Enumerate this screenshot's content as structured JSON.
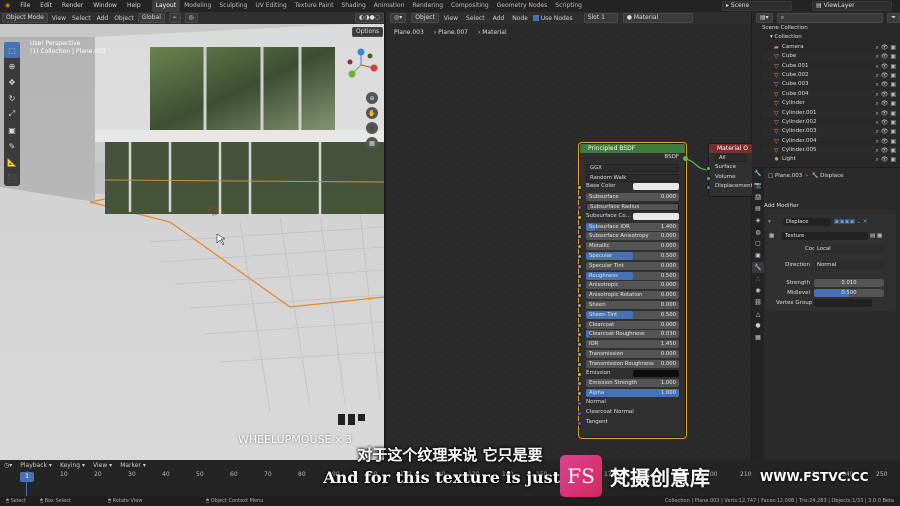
{
  "top_menu": [
    "File",
    "Edit",
    "Render",
    "Window",
    "Help"
  ],
  "workspaces": [
    "Layout",
    "Modeling",
    "Sculpting",
    "UV Editing",
    "Texture Paint",
    "Shading",
    "Animation",
    "Rendering",
    "Compositing",
    "Geometry Nodes",
    "Scripting"
  ],
  "scene": "Scene",
  "view_layer": "ViewLayer",
  "viewport": {
    "mode": "Object Mode",
    "menus": [
      "View",
      "Select",
      "Add",
      "Object"
    ],
    "orientation": "Global",
    "perspective_label": "User Perspective",
    "collection_label": "(1) Collection | Plane.003",
    "options": "Options",
    "keypress_overlay": "WHEELUPMOUSE x 3"
  },
  "node_editor": {
    "type": "Object",
    "menus": [
      "View",
      "Select",
      "Add",
      "Node"
    ],
    "use_nodes": "Use Nodes",
    "slot": "Slot 1",
    "material": "Material",
    "breadcrumb": [
      "Plane.003",
      "Plane.007",
      "Material"
    ],
    "bsdf_node": {
      "title": "Principled BSDF",
      "output": "BSDF",
      "distribution": "GGX",
      "subsurface_method": "Random Walk",
      "rows": [
        {
          "label": "Base Color",
          "kind": "color"
        },
        {
          "label": "Subsurface",
          "value": "0.000",
          "fill": 0
        },
        {
          "label": "Subsurface Radius",
          "kind": "dd"
        },
        {
          "label": "Subsurface Co...",
          "kind": "color"
        },
        {
          "label": "Subsurface IOR",
          "value": "1.400",
          "fill": 0.1
        },
        {
          "label": "Subsurface Anisotropy",
          "value": "0.000",
          "fill": 0
        },
        {
          "label": "Metallic",
          "value": "0.000",
          "fill": 0
        },
        {
          "label": "Specular",
          "value": "0.500",
          "fill": 0.5
        },
        {
          "label": "Specular Tint",
          "value": "0.000",
          "fill": 0
        },
        {
          "label": "Roughness",
          "value": "0.500",
          "fill": 0.5
        },
        {
          "label": "Anisotropic",
          "value": "0.000",
          "fill": 0
        },
        {
          "label": "Anisotropic Rotation",
          "value": "0.000",
          "fill": 0
        },
        {
          "label": "Sheen",
          "value": "0.000",
          "fill": 0
        },
        {
          "label": "Sheen Tint",
          "value": "0.500",
          "fill": 0.5
        },
        {
          "label": "Clearcoat",
          "value": "0.000",
          "fill": 0
        },
        {
          "label": "Clearcoat Roughness",
          "value": "0.030",
          "fill": 0.03
        },
        {
          "label": "IOR",
          "value": "1.450",
          "fill": 0
        },
        {
          "label": "Transmission",
          "value": "0.000",
          "fill": 0
        },
        {
          "label": "Transmission Roughness",
          "value": "0.000",
          "fill": 0
        },
        {
          "label": "Emission",
          "kind": "black"
        },
        {
          "label": "Emission Strength",
          "value": "1.000",
          "fill": 0
        },
        {
          "label": "Alpha",
          "value": "1.000",
          "fill": 1
        },
        {
          "label": "Normal",
          "kind": "plain"
        },
        {
          "label": "Clearcoat Normal",
          "kind": "plain"
        },
        {
          "label": "Tangent",
          "kind": "plain"
        }
      ]
    },
    "output_node": {
      "title": "Material O",
      "target": "All",
      "inputs": [
        "Surface",
        "Volume",
        "Displacement"
      ]
    }
  },
  "outliner": {
    "root": "Scene Collection",
    "collection": "Collection",
    "items": [
      "Camera",
      "Cube",
      "Cube.001",
      "Cube.002",
      "Cube.003",
      "Cube.004",
      "Cylinder",
      "Cylinder.001",
      "Cylinder.002",
      "Cylinder.003",
      "Cylinder.004",
      "Cylinder.005",
      "Light"
    ]
  },
  "properties": {
    "object": "Plane.003",
    "modifier_name": "Displace",
    "add_modifier": "Add Modifier",
    "mod_name": "Displace",
    "texture": "Texture",
    "coordinates_label": "Coordinates",
    "coordinates": "Local",
    "direction_label": "Direction",
    "direction": "Normal",
    "strength_label": "Strength",
    "strength": "0.010",
    "midlevel_label": "Midlevel",
    "midlevel": "0.500",
    "vertex_group_label": "Vertex Group"
  },
  "timeline": {
    "menus": [
      "Playback",
      "Keying",
      "View",
      "Marker"
    ],
    "current_frame": "1",
    "ticks": [
      "1",
      "10",
      "20",
      "30",
      "40",
      "50",
      "60",
      "70",
      "80",
      "90",
      "100",
      "110",
      "120",
      "130",
      "140",
      "150",
      "160",
      "170",
      "180",
      "190",
      "200",
      "210",
      "220",
      "230",
      "240",
      "250"
    ]
  },
  "status": {
    "select": "Select",
    "box_select": "Box Select",
    "rotate": "Rotate View",
    "context": "Object Context Menu",
    "stats": "Collection | Plane.003 | Verts:12,747 | Faces:12,098 | Tris:24,283 | Objects:1/33 | 3.0.0 Beta"
  },
  "subtitles": {
    "chinese": "对于这个纹理来说 它只是要",
    "english": "And for this texture is just g"
  },
  "watermark": {
    "logo": "FS",
    "text": "梵摄创意库",
    "url": "WWW.FSTVC.CC"
  }
}
